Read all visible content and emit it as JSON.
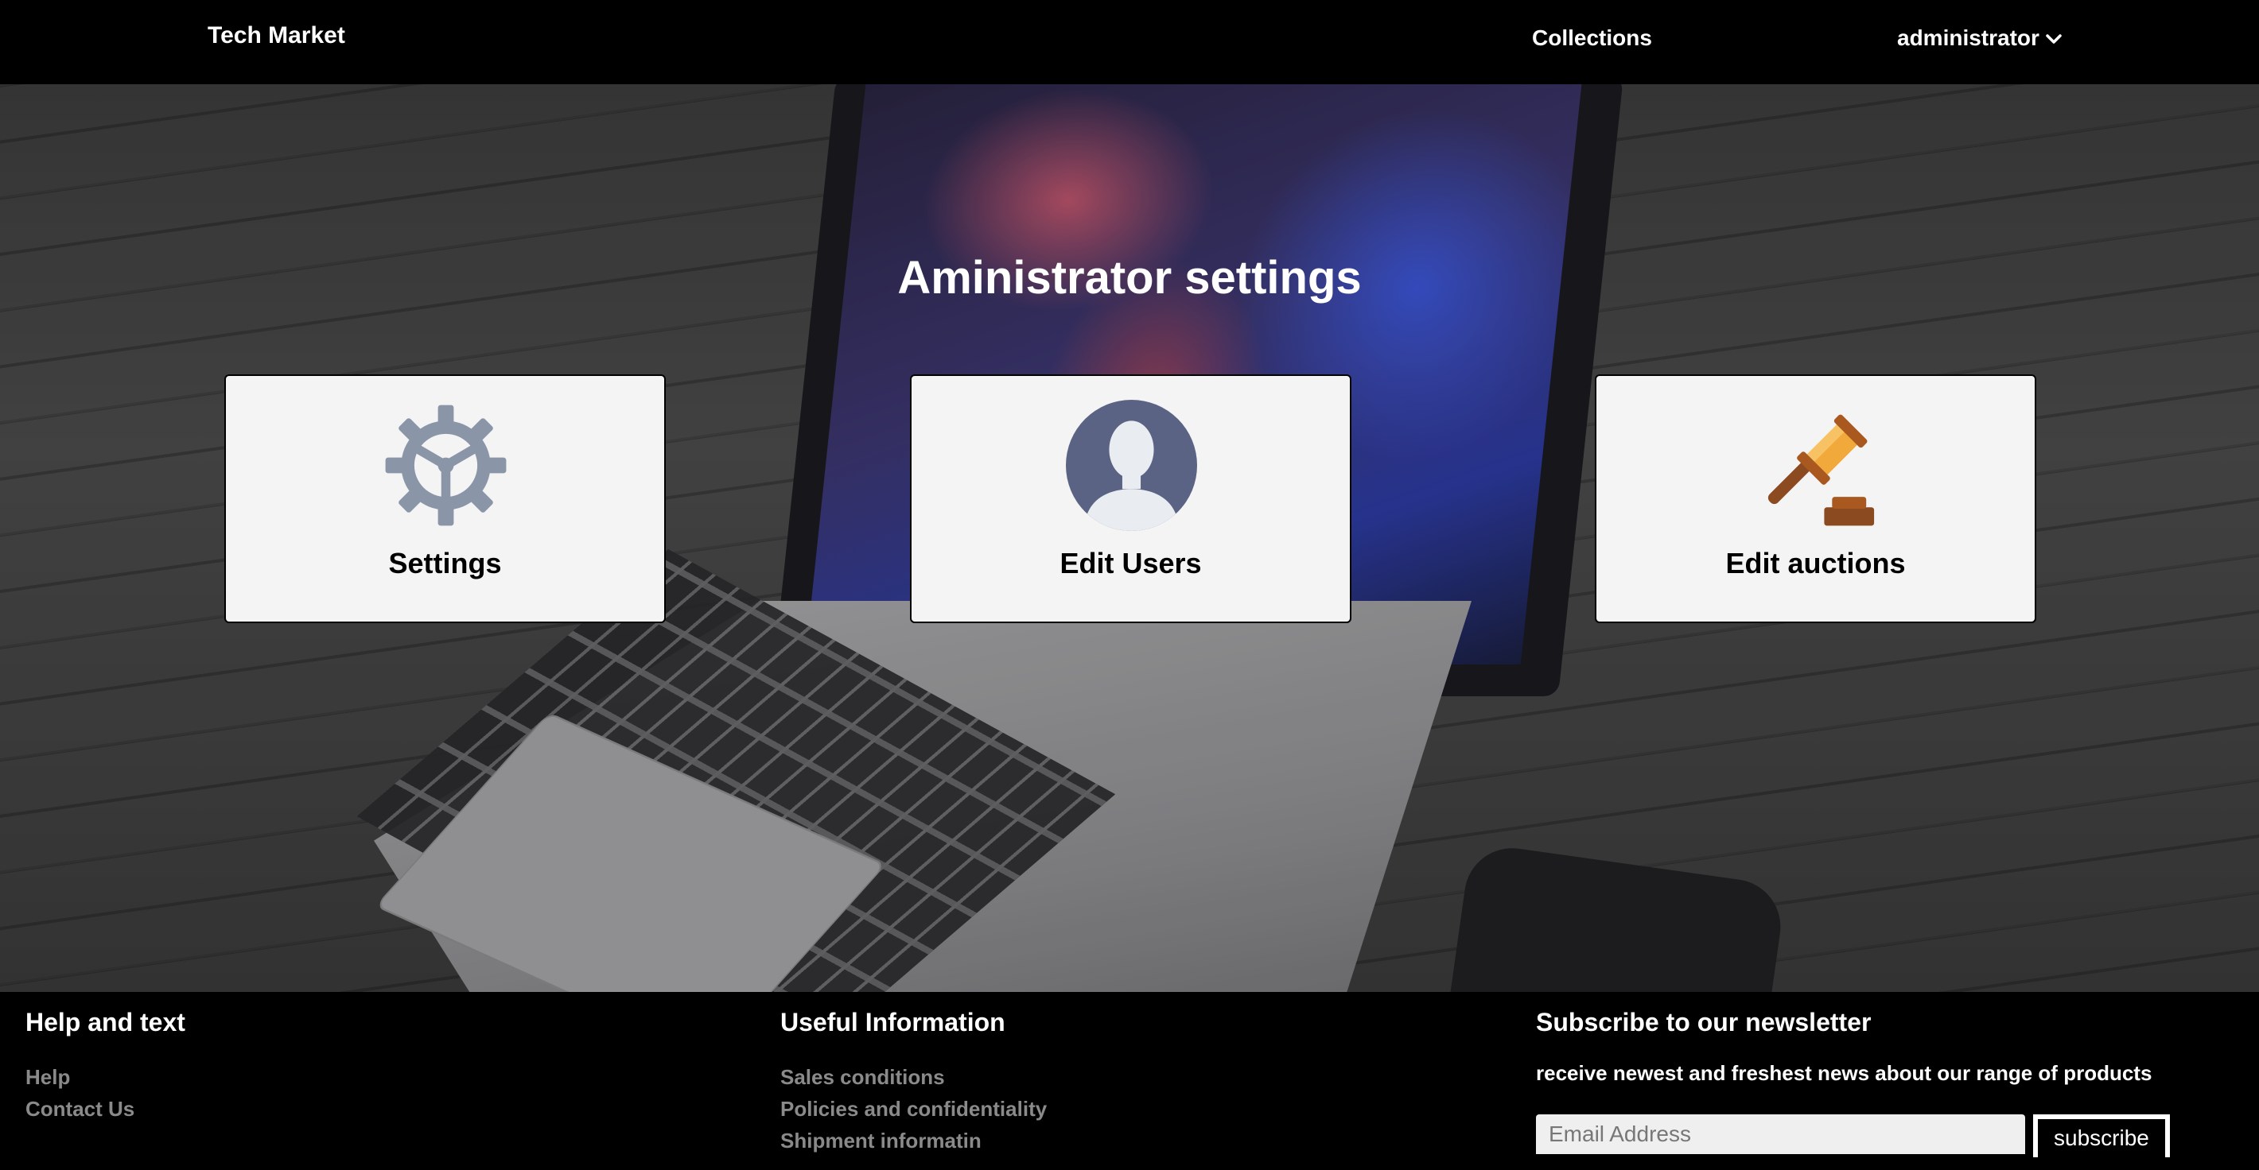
{
  "navbar": {
    "brand": "Tech Market",
    "collections": "Collections",
    "user": "administrator"
  },
  "hero": {
    "title": "Aministrator settings"
  },
  "cards": [
    {
      "label": "Settings",
      "icon": "gear-icon"
    },
    {
      "label": "Edit Users",
      "icon": "user-avatar-icon"
    },
    {
      "label": "Edit auctions",
      "icon": "gavel-icon"
    }
  ],
  "footer": {
    "col1": {
      "title": "Help and text",
      "links": [
        "Help",
        "Contact Us"
      ]
    },
    "col2": {
      "title": "Useful Information",
      "links": [
        "Sales conditions",
        "Policies and confidentiality",
        "Shipment informatin"
      ]
    },
    "col3": {
      "title": "Subscribe to our newsletter",
      "text": "receive newest and freshest news about our range of products",
      "email_placeholder": "Email Address",
      "button": "subscribe"
    }
  },
  "colors": {
    "navbar_bg": "#000000",
    "card_bg": "#f4f4f4",
    "footer_link": "#8a8a8a",
    "gear": "#8a96a8",
    "avatar_bg": "#5a6383",
    "gavel_head": "#f2a93b",
    "gavel_handle": "#8b4a1f"
  }
}
